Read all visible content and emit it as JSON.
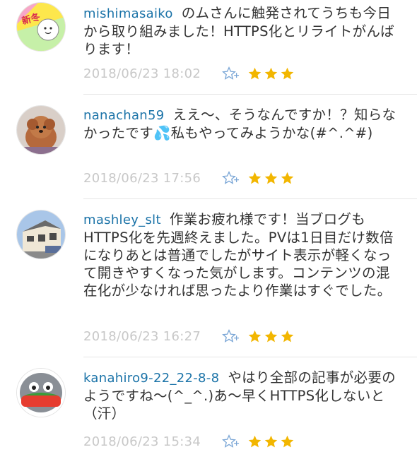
{
  "comments": [
    {
      "user": "mishimasaiko",
      "text": "のムさんに触発されてうちも今日から取り組みました！HTTPS化とリライトがんばります！",
      "timestamp": "2018/06/23 18:02",
      "avatar": "new-winter-avatar",
      "avatar_text": "新冬",
      "stars": 3
    },
    {
      "user": "nanachan59",
      "text": "ええ〜、そうなんですか！？知らなかったです💦私もやってみようかな(#^.^#)",
      "timestamp": "2018/06/23 17:56",
      "avatar": "dog-avatar",
      "stars": 3
    },
    {
      "user": "mashley_slt",
      "text": "作業お疲れ様です！当ブログもHTTPS化を先週終えました。PVは1日目だけ数倍になりあとは普通でしたがサイト表示が軽くなって開きやすくなった気がします。コンテンツの混在化が少なければ思ったより作業はすぐでした。",
      "timestamp": "2018/06/23 16:27",
      "avatar": "house-avatar",
      "stars": 3
    },
    {
      "user": "kanahiro9-22_22-8-8",
      "text": "やはり全部の記事が必要のようですね〜(^_^.)あ〜早くHTTPS化しないと（汗）",
      "timestamp": "2018/06/23 15:34",
      "avatar": "character-avatar",
      "stars": 3
    }
  ],
  "colors": {
    "username": "#1b73a8",
    "timestamp": "#c8c8c8",
    "star": "#f2b600",
    "add_star": "#7aa6d6",
    "divider": "#e6e6e6"
  }
}
